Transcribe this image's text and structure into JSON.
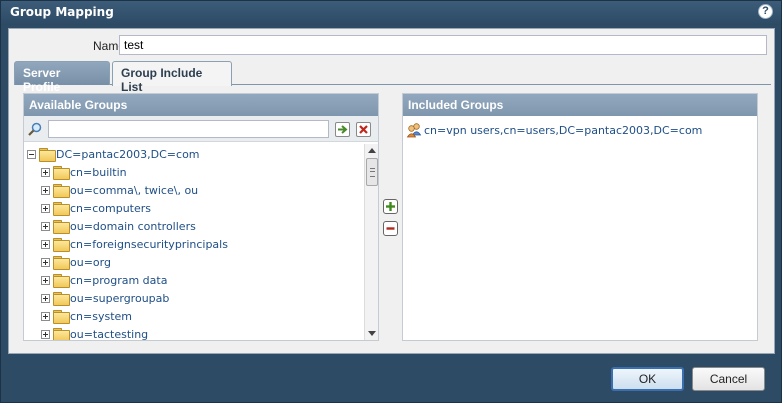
{
  "dialog": {
    "title": "Group Mapping",
    "help_label": "?"
  },
  "name_field": {
    "label": "Name",
    "value": "test"
  },
  "tabs": [
    {
      "label": "Server Profile"
    },
    {
      "label": "Group Include List"
    }
  ],
  "available": {
    "header": "Available Groups",
    "search_value": "",
    "tree": {
      "root": "DC=pantac2003,DC=com",
      "children": [
        "cn=builtin",
        "ou=comma\\, twice\\, ou",
        "cn=computers",
        "ou=domain controllers",
        "cn=foreignsecurityprincipals",
        "ou=org",
        "cn=program data",
        "ou=supergroupab",
        "cn=system",
        "ou=tactesting"
      ]
    }
  },
  "included": {
    "header": "Included Groups",
    "items": [
      "cn=vpn users,cn=users,DC=pantac2003,DC=com"
    ]
  },
  "footer": {
    "ok_label": "OK",
    "cancel_label": "Cancel"
  },
  "colors": {
    "dialog_bg": "#2e4b65",
    "panel_header": "#869db4",
    "tree_text": "#1f4f86",
    "ok_border": "#3a6fb0"
  }
}
